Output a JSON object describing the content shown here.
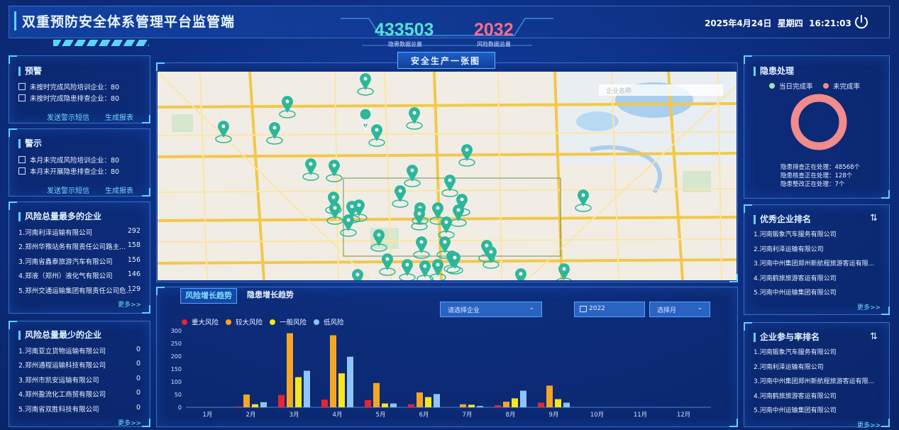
{
  "header": {
    "title": "双重预防安全体系管理平台监管端",
    "hidden_total": "433503",
    "hidden_total_label": "隐患数据总量",
    "risk_total": "2032",
    "risk_total_label": "风险数据总量",
    "datetime": "2025年4月24日  星期四  16:21:03",
    "power_icon": "power-icon"
  },
  "warning": {
    "title": "预警",
    "items": [
      "未按时完成风险培训企业：80",
      "未按时完成隐患排查企业：80"
    ],
    "sms": "发送警示短信",
    "report": "生成报表"
  },
  "alert": {
    "title": "警示",
    "items": [
      "本月未完成风险培训企业：80",
      "本月未开展隐患排查企业：80"
    ],
    "sms": "发送警示短信",
    "report": "生成报表"
  },
  "most_risk": {
    "title": "风险总量最多的企业",
    "rows": [
      {
        "name": "1.河南利泽运输有限公司",
        "value": "292"
      },
      {
        "name": "2.郑州华豫站务有限责任公司路主...",
        "value": "158"
      },
      {
        "name": "3.河南省鑫泰旅游汽车有限公司",
        "value": "156"
      },
      {
        "name": "4.郑液（郑州）液化气有限公司",
        "value": "146"
      },
      {
        "name": "5.郑州交通运输集团有限责任公司危...",
        "value": "129"
      }
    ],
    "more": "更多>>"
  },
  "least_risk": {
    "title": "风险总量最少的企业",
    "rows": [
      {
        "name": "1.河南亚立货物运输有限公司",
        "value": "0"
      },
      {
        "name": "2.郑州通程运输科技有限公司",
        "value": "0"
      },
      {
        "name": "3.郑州市凯安运输有限公司",
        "value": "0"
      },
      {
        "name": "4.郑州盈流化工商贸有限公司",
        "value": "0"
      },
      {
        "name": "5.河南省双胜科技有限公司",
        "value": "0"
      }
    ],
    "more": "更多>>"
  },
  "map": {
    "title": "安全生产一张图",
    "search_placeholder": "企业名称"
  },
  "trend": {
    "tabs": [
      "风险增长趋势",
      "隐患增长趋势"
    ],
    "enterprise_select": "请选择企业",
    "year": "2022",
    "month_select": "选择月",
    "calendar_icon": "calendar-icon",
    "chevron_icon": "chevron-down-icon"
  },
  "hazard": {
    "title": "隐患处理",
    "legend": [
      "当日完成率",
      "未完成率"
    ],
    "legend_colors": [
      "#9be7a8",
      "#f28b8b"
    ],
    "stats": [
      "隐患排查正在处理：48568个",
      "隐患核查正在处理：128个",
      "隐患整改正在处理：7个"
    ]
  },
  "excellent": {
    "title": "优秀企业排名",
    "rows": [
      "1.河南锻象汽车服务有限公司",
      "2.河南利泽运输有限公司",
      "3.河南中州集团郑州新航程旅游客运有限...",
      "4.河南鹤旅旅游客运有限公司",
      "5.河南中州运输集团有限公司"
    ],
    "more": "更多>>"
  },
  "participation": {
    "title": "企业参与率排名",
    "rows": [
      "1.河南锻象汽车服务有限公司",
      "2.河南利泽运输有限公司",
      "3.河南中州集团郑州新航程旅游客运有限...",
      "4.河南鹤旅旅游客运有限公司",
      "5.河南中州运输集团有限公司"
    ],
    "more": "更多>>"
  },
  "chart_data": {
    "type": "bar",
    "categories": [
      "1月",
      "2月",
      "3月",
      "4月",
      "5月",
      "6月",
      "7月",
      "8月",
      "9月",
      "10月",
      "11月",
      "12月"
    ],
    "series": [
      {
        "name": "重大风险",
        "color": "#e8242e",
        "values": [
          0,
          3,
          48,
          30,
          28,
          12,
          0,
          8,
          18,
          0,
          0,
          0
        ]
      },
      {
        "name": "较大风险",
        "color": "#f5a623",
        "values": [
          0,
          50,
          290,
          282,
          95,
          58,
          12,
          22,
          85,
          0,
          0,
          0
        ]
      },
      {
        "name": "一般风险",
        "color": "#f8e71c",
        "values": [
          0,
          12,
          118,
          133,
          15,
          40,
          10,
          35,
          32,
          0,
          0,
          0
        ]
      },
      {
        "name": "低风险",
        "color": "#8fc5ff",
        "values": [
          0,
          20,
          143,
          198,
          15,
          52,
          5,
          65,
          18,
          0,
          0,
          0
        ]
      }
    ],
    "ylim": [
      0,
      300
    ],
    "yticks": [
      "0",
      "50",
      "100",
      "150",
      "200",
      "250",
      "300"
    ],
    "grid": false,
    "legend": "top-left"
  },
  "donut": {
    "complete_rate": 0,
    "incomplete_rate": 100
  }
}
